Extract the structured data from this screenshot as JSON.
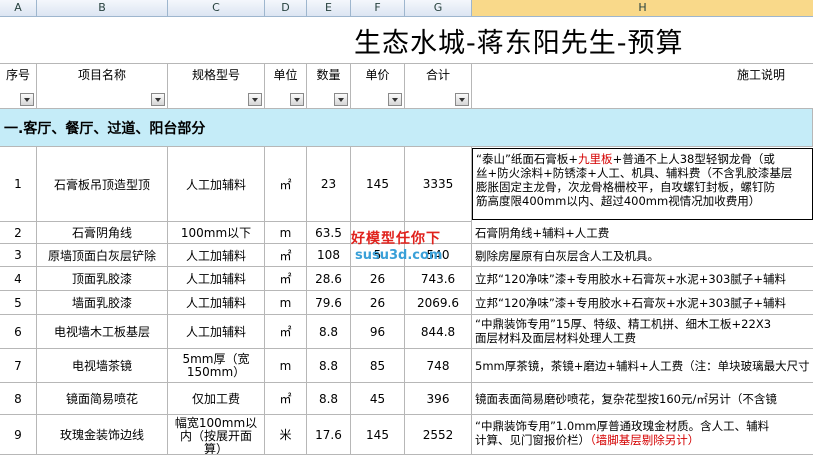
{
  "columns": [
    "A",
    "B",
    "C",
    "D",
    "E",
    "F",
    "G",
    "H"
  ],
  "title": "生态水城-蒋东阳先生-预算",
  "headers": {
    "no": "序号",
    "name": "项目名称",
    "spec": "规格型号",
    "unit": "单位",
    "qty": "数量",
    "price": "单价",
    "total": "合计",
    "desc": "施工说明"
  },
  "section": "一.客厅、餐厅、过道、阳台部分",
  "rows": [
    {
      "no": "1",
      "name": "石膏板吊顶造型顶",
      "spec": "人工加辅料",
      "unit": "㎡",
      "qty": "23",
      "price": "145",
      "total": "3335",
      "desc_a": "“泰山”纸面石膏板+",
      "desc_red": "九里板",
      "desc_b": "+普通不上人38型轻钢龙骨（或",
      "desc2": "丝+防火涂料+防锈漆+人工、机具、辅料费（不含乳胶漆基层",
      "desc3": "膨胀固定主龙骨，次龙骨格栅校平，自攻螺钉封板，螺钉防",
      "desc4": "筋高度限400mm以内、超过400mm视情况加收费用）"
    },
    {
      "no": "2",
      "name": "石膏阴角线",
      "spec": "100mm以下",
      "unit": "m",
      "qty": "63.5",
      "price": "",
      "total": "",
      "desc": "石膏阴角线+辅料+人工费"
    },
    {
      "no": "3",
      "name": "原墙顶面白灰层铲除",
      "spec": "人工加辅料",
      "unit": "㎡",
      "qty": "108",
      "price": "5",
      "total": "540",
      "desc": "剔除房屋原有白灰层含人工及机具。"
    },
    {
      "no": "4",
      "name": "顶面乳胶漆",
      "spec": "人工加辅料",
      "unit": "㎡",
      "qty": "28.6",
      "price": "26",
      "total": "743.6",
      "desc": "立邦“120净味”漆+专用胶水+石膏灰+水泥+303腻子+辅料"
    },
    {
      "no": "5",
      "name": "墙面乳胶漆",
      "spec": "人工加辅料",
      "unit": "m",
      "qty": "79.6",
      "price": "26",
      "total": "2069.6",
      "desc": "立邦“120净味”漆+专用胶水+石膏灰+水泥+303腻子+辅料"
    },
    {
      "no": "6",
      "name": "电视墙木工板基层",
      "spec": "人工加辅料",
      "unit": "㎡",
      "qty": "8.8",
      "price": "96",
      "total": "844.8",
      "desc": "“中鼎装饰专用”15厚、特级、精工机拼、细木工板+22X3",
      "desc2": "面层材料及面层材料处理人工费"
    },
    {
      "no": "7",
      "name": "电视墙茶镜",
      "spec": "5mm厚（宽150mm）",
      "unit": "m",
      "qty": "8.8",
      "price": "85",
      "total": "748",
      "desc": "5mm厚茶镜，茶镜+磨边+辅料+人工费（注：单块玻璃最大尺寸"
    },
    {
      "no": "8",
      "name": "镜面简易喷花",
      "spec": "仅加工费",
      "unit": "㎡",
      "qty": "8.8",
      "price": "45",
      "total": "396",
      "desc": "镜面表面简易磨砂喷花，复杂花型按160元/㎡另计（不含镜"
    },
    {
      "no": "9",
      "name": "玫瑰金装饰边线",
      "spec": "幅宽100mm以内（按展开面算）",
      "unit": "米",
      "qty": "17.6",
      "price": "145",
      "total": "2552",
      "desc": "“中鼎装饰专用”1.0mm厚普通玫瑰金材质。含人工、辅料",
      "desc2a": "计算、见门窗报价栏）",
      "desc2_red": "（墙脚基层剔除另计）"
    }
  ],
  "watermark": {
    "line1": "好模型任你下",
    "line2": "susu3d.com"
  }
}
